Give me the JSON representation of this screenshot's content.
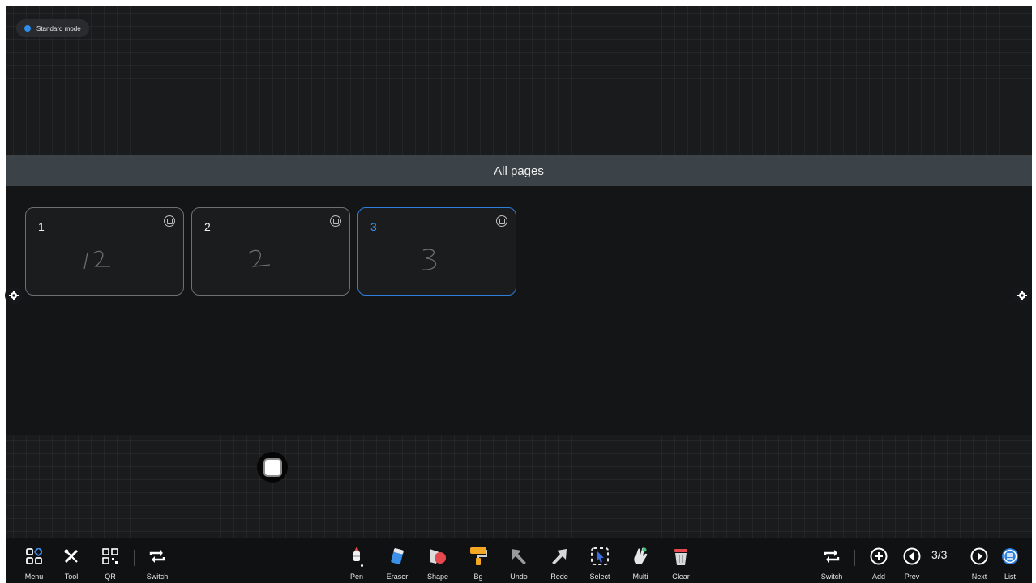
{
  "mode_badge": {
    "label": "Standard mode",
    "dot_color": "#2e8ef0"
  },
  "overlay": {
    "title": "All pages",
    "pages": [
      {
        "number": "1",
        "scribble": "12",
        "active": false
      },
      {
        "number": "2",
        "scribble": "2",
        "active": false
      },
      {
        "number": "3",
        "scribble": "3",
        "active": true
      }
    ]
  },
  "toolbar": {
    "left": [
      {
        "label": "Menu",
        "icon": "menu-grid-icon"
      },
      {
        "label": "Tool",
        "icon": "tools-icon"
      },
      {
        "label": "QR",
        "icon": "qr-code-icon"
      },
      {
        "label": "Switch",
        "icon": "switch-arrows-icon"
      }
    ],
    "center": [
      {
        "label": "Pen",
        "icon": "pen-icon"
      },
      {
        "label": "Eraser",
        "icon": "eraser-icon"
      },
      {
        "label": "Shape",
        "icon": "shape-icon"
      },
      {
        "label": "Bg",
        "icon": "paint-roller-icon"
      },
      {
        "label": "Undo",
        "icon": "undo-arrow-icon"
      },
      {
        "label": "Redo",
        "icon": "redo-arrow-icon"
      },
      {
        "label": "Select",
        "icon": "select-icon"
      },
      {
        "label": "Multi",
        "icon": "multi-touch-icon"
      },
      {
        "label": "Clear",
        "icon": "trash-icon"
      }
    ],
    "right": [
      {
        "label": "Switch",
        "icon": "switch-arrows-icon"
      },
      {
        "label": "Add",
        "icon": "add-circle-icon"
      },
      {
        "label": "Prev",
        "icon": "prev-circle-icon"
      },
      {
        "label": "Next",
        "icon": "next-circle-icon"
      },
      {
        "label": "List",
        "icon": "list-circle-icon"
      }
    ],
    "page_counter": "3/3"
  },
  "colors": {
    "accent": "#2f7fdc",
    "background": "#1a1b1d"
  }
}
